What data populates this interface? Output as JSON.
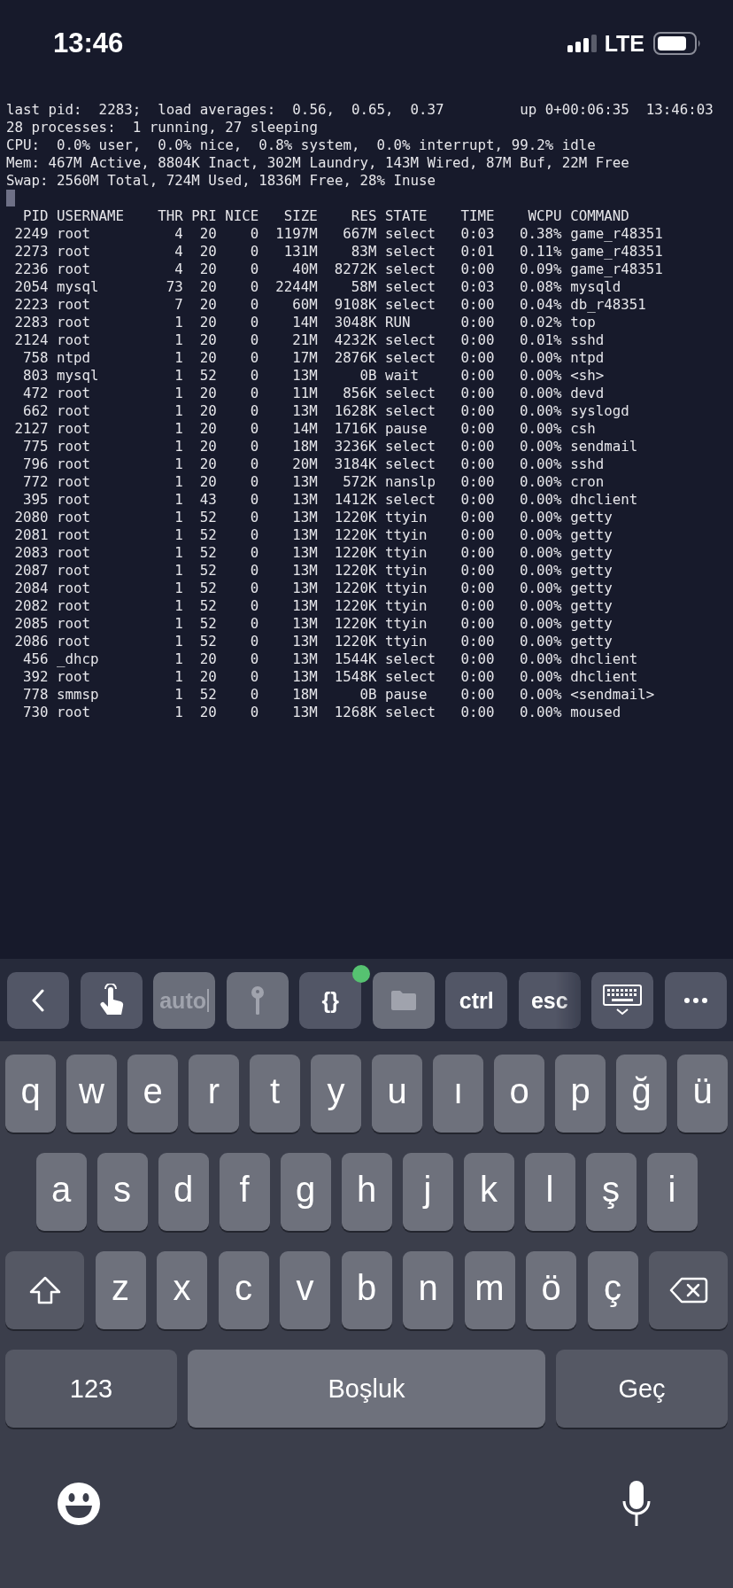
{
  "status_bar": {
    "time": "13:46",
    "network": "LTE"
  },
  "terminal": {
    "summary": [
      "last pid:  2283;  load averages:  0.56,  0.65,  0.37         up 0+00:06:35  13:46:03",
      "28 processes:  1 running, 27 sleeping",
      "CPU:  0.0% user,  0.0% nice,  0.8% system,  0.0% interrupt, 99.2% idle",
      "Mem: 467M Active, 8804K Inact, 302M Laundry, 143M Wired, 87M Buf, 22M Free",
      "Swap: 2560M Total, 724M Used, 1836M Free, 28% Inuse"
    ],
    "cursor_visible": true,
    "table": {
      "columns": [
        "PID",
        "USERNAME",
        "THR",
        "PRI",
        "NICE",
        "SIZE",
        "RES",
        "STATE",
        "TIME",
        "WCPU",
        "COMMAND"
      ],
      "rows": [
        [
          "2249",
          "root",
          "4",
          "20",
          "0",
          "1197M",
          "667M",
          "select",
          "0:03",
          "0.38%",
          "game_r48351"
        ],
        [
          "2273",
          "root",
          "4",
          "20",
          "0",
          "131M",
          "83M",
          "select",
          "0:01",
          "0.11%",
          "game_r48351"
        ],
        [
          "2236",
          "root",
          "4",
          "20",
          "0",
          "40M",
          "8272K",
          "select",
          "0:00",
          "0.09%",
          "game_r48351"
        ],
        [
          "2054",
          "mysql",
          "73",
          "20",
          "0",
          "2244M",
          "58M",
          "select",
          "0:03",
          "0.08%",
          "mysqld"
        ],
        [
          "2223",
          "root",
          "7",
          "20",
          "0",
          "60M",
          "9108K",
          "select",
          "0:00",
          "0.04%",
          "db_r48351"
        ],
        [
          "2283",
          "root",
          "1",
          "20",
          "0",
          "14M",
          "3048K",
          "RUN",
          "0:00",
          "0.02%",
          "top"
        ],
        [
          "2124",
          "root",
          "1",
          "20",
          "0",
          "21M",
          "4232K",
          "select",
          "0:00",
          "0.01%",
          "sshd"
        ],
        [
          "758",
          "ntpd",
          "1",
          "20",
          "0",
          "17M",
          "2876K",
          "select",
          "0:00",
          "0.00%",
          "ntpd"
        ],
        [
          "803",
          "mysql",
          "1",
          "52",
          "0",
          "13M",
          "0B",
          "wait",
          "0:00",
          "0.00%",
          "<sh>"
        ],
        [
          "472",
          "root",
          "1",
          "20",
          "0",
          "11M",
          "856K",
          "select",
          "0:00",
          "0.00%",
          "devd"
        ],
        [
          "662",
          "root",
          "1",
          "20",
          "0",
          "13M",
          "1628K",
          "select",
          "0:00",
          "0.00%",
          "syslogd"
        ],
        [
          "2127",
          "root",
          "1",
          "20",
          "0",
          "14M",
          "1716K",
          "pause",
          "0:00",
          "0.00%",
          "csh"
        ],
        [
          "775",
          "root",
          "1",
          "20",
          "0",
          "18M",
          "3236K",
          "select",
          "0:00",
          "0.00%",
          "sendmail"
        ],
        [
          "796",
          "root",
          "1",
          "20",
          "0",
          "20M",
          "3184K",
          "select",
          "0:00",
          "0.00%",
          "sshd"
        ],
        [
          "772",
          "root",
          "1",
          "20",
          "0",
          "13M",
          "572K",
          "nanslp",
          "0:00",
          "0.00%",
          "cron"
        ],
        [
          "395",
          "root",
          "1",
          "43",
          "0",
          "13M",
          "1412K",
          "select",
          "0:00",
          "0.00%",
          "dhclient"
        ],
        [
          "2080",
          "root",
          "1",
          "52",
          "0",
          "13M",
          "1220K",
          "ttyin",
          "0:00",
          "0.00%",
          "getty"
        ],
        [
          "2081",
          "root",
          "1",
          "52",
          "0",
          "13M",
          "1220K",
          "ttyin",
          "0:00",
          "0.00%",
          "getty"
        ],
        [
          "2083",
          "root",
          "1",
          "52",
          "0",
          "13M",
          "1220K",
          "ttyin",
          "0:00",
          "0.00%",
          "getty"
        ],
        [
          "2087",
          "root",
          "1",
          "52",
          "0",
          "13M",
          "1220K",
          "ttyin",
          "0:00",
          "0.00%",
          "getty"
        ],
        [
          "2084",
          "root",
          "1",
          "52",
          "0",
          "13M",
          "1220K",
          "ttyin",
          "0:00",
          "0.00%",
          "getty"
        ],
        [
          "2082",
          "root",
          "1",
          "52",
          "0",
          "13M",
          "1220K",
          "ttyin",
          "0:00",
          "0.00%",
          "getty"
        ],
        [
          "2085",
          "root",
          "1",
          "52",
          "0",
          "13M",
          "1220K",
          "ttyin",
          "0:00",
          "0.00%",
          "getty"
        ],
        [
          "2086",
          "root",
          "1",
          "52",
          "0",
          "13M",
          "1220K",
          "ttyin",
          "0:00",
          "0.00%",
          "getty"
        ],
        [
          "456",
          "_dhcp",
          "1",
          "20",
          "0",
          "13M",
          "1544K",
          "select",
          "0:00",
          "0.00%",
          "dhclient"
        ],
        [
          "392",
          "root",
          "1",
          "20",
          "0",
          "13M",
          "1548K",
          "select",
          "0:00",
          "0.00%",
          "dhclient"
        ],
        [
          "778",
          "smmsp",
          "1",
          "52",
          "0",
          "18M",
          "0B",
          "pause",
          "0:00",
          "0.00%",
          "<sendmail>"
        ],
        [
          "730",
          "root",
          "1",
          "20",
          "0",
          "13M",
          "1268K",
          "select",
          "0:00",
          "0.00%",
          "moused"
        ]
      ]
    }
  },
  "toolbar": [
    {
      "kind": "back",
      "disabled": false
    },
    {
      "kind": "touch",
      "disabled": false
    },
    {
      "kind": "input",
      "label": "auto",
      "disabled": true
    },
    {
      "kind": "key",
      "disabled": true
    },
    {
      "kind": "text",
      "label": "{}",
      "disabled": false,
      "indicator": true
    },
    {
      "kind": "folder",
      "disabled": true
    },
    {
      "kind": "text",
      "label": "ctrl",
      "disabled": false
    },
    {
      "kind": "text",
      "label": "esc",
      "disabled": false
    },
    {
      "kind": "keyboard",
      "disabled": false
    },
    {
      "kind": "more",
      "disabled": false
    }
  ],
  "keyboard": {
    "rows": [
      [
        {
          "kind": "letter",
          "label": "q"
        },
        {
          "kind": "letter",
          "label": "w"
        },
        {
          "kind": "letter",
          "label": "e"
        },
        {
          "kind": "letter",
          "label": "r"
        },
        {
          "kind": "letter",
          "label": "t"
        },
        {
          "kind": "letter",
          "label": "y"
        },
        {
          "kind": "letter",
          "label": "u"
        },
        {
          "kind": "letter",
          "label": "ı"
        },
        {
          "kind": "letter",
          "label": "o"
        },
        {
          "kind": "letter",
          "label": "p"
        },
        {
          "kind": "letter",
          "label": "ğ"
        },
        {
          "kind": "letter",
          "label": "ü"
        }
      ],
      [
        {
          "kind": "letter",
          "label": "a"
        },
        {
          "kind": "letter",
          "label": "s"
        },
        {
          "kind": "letter",
          "label": "d"
        },
        {
          "kind": "letter",
          "label": "f"
        },
        {
          "kind": "letter",
          "label": "g"
        },
        {
          "kind": "letter",
          "label": "h"
        },
        {
          "kind": "letter",
          "label": "j"
        },
        {
          "kind": "letter",
          "label": "k"
        },
        {
          "kind": "letter",
          "label": "l"
        },
        {
          "kind": "letter",
          "label": "ş"
        },
        {
          "kind": "letter",
          "label": "i"
        }
      ],
      [
        {
          "kind": "shift"
        },
        {
          "kind": "letter",
          "label": "z"
        },
        {
          "kind": "letter",
          "label": "x"
        },
        {
          "kind": "letter",
          "label": "c"
        },
        {
          "kind": "letter",
          "label": "v"
        },
        {
          "kind": "letter",
          "label": "b"
        },
        {
          "kind": "letter",
          "label": "n"
        },
        {
          "kind": "letter",
          "label": "m"
        },
        {
          "kind": "letter",
          "label": "ö"
        },
        {
          "kind": "letter",
          "label": "ç"
        },
        {
          "kind": "backspace"
        }
      ]
    ],
    "function_row": [
      {
        "kind": "mode",
        "label": "123"
      },
      {
        "kind": "space",
        "label": "Boşluk"
      },
      {
        "kind": "return",
        "label": "Geç"
      }
    ],
    "bottom": [
      {
        "kind": "emoji"
      },
      {
        "kind": "dictation"
      }
    ]
  }
}
